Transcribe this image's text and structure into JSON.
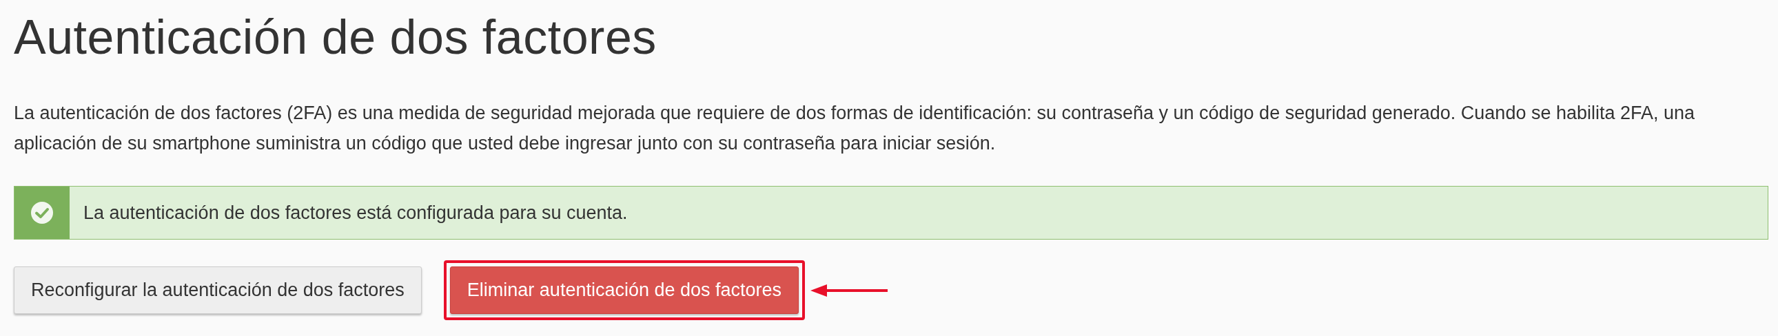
{
  "title": "Autenticación de dos factores",
  "description": "La autenticación de dos factores (2FA) es una medida de seguridad mejorada que requiere de dos formas de identificación: su contraseña y un código de seguridad generado. Cuando se habilita 2FA, una aplicación de su smartphone suministra un código que usted debe ingresar junto con su contraseña para iniciar sesión.",
  "alert": {
    "kind": "success",
    "message": "La autenticación de dos factores está configurada para su cuenta."
  },
  "buttons": [
    {
      "label": "Reconfigurar la autenticación de dos factores",
      "kind": "default",
      "highlighted": false
    },
    {
      "label": "Eliminar autenticación de dos factores",
      "kind": "danger",
      "highlighted": true
    }
  ]
}
